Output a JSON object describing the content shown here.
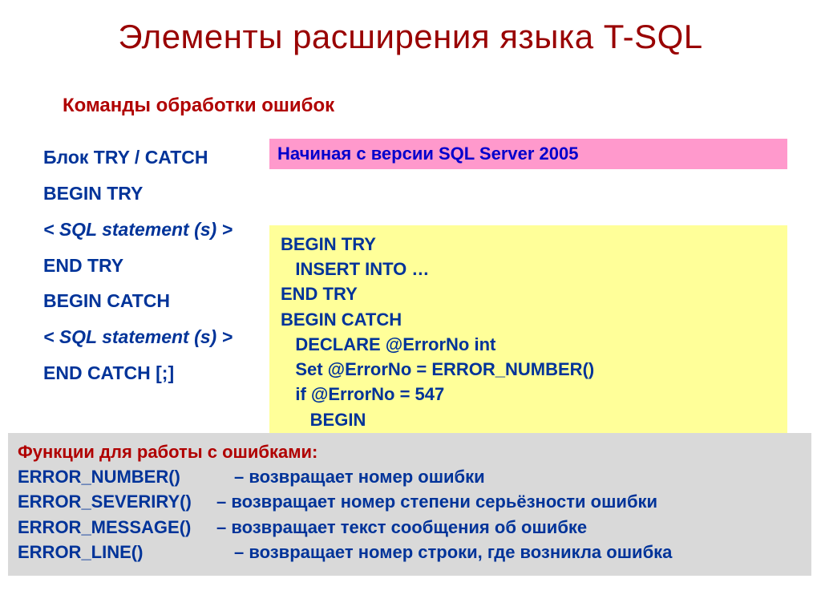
{
  "title": "Элементы расширения языка T-SQL",
  "subtitle": "Команды обработки ошибок",
  "left": {
    "l1": "Блок TRY / CATCH",
    "l2": "BEGIN TRY",
    "l3": " < SQL statement (s)  >",
    "l4": "END TRY",
    "l5": "BEGIN CATCH",
    "l6": "< SQL statement (s) >",
    "l7": " END CATCH [;]"
  },
  "pink": "Начиная с версии SQL Server 2005",
  "yellow": "BEGIN TRY\n   INSERT INTO …\nEND TRY\nBEGIN CATCH\n   DECLARE @ErrorNo int\n   Set @ErrorNo = ERROR_NUMBER()\n   if @ErrorNo = 547\n      BEGIN",
  "gray": {
    "title": "Функции для работы с ошибками:",
    "rows": [
      {
        "fn": "ERROR_NUMBER()",
        "desc": "– возвращает номер ошибки"
      },
      {
        "fn": "ERROR_SEVERIRY()",
        "desc": "– возвращает номер степени серьёзности ошибки"
      },
      {
        "fn": "ERROR_MESSAGE()",
        "desc": "– возвращает текст сообщения об ошибке"
      },
      {
        "fn": "ERROR_LINE()",
        "desc": "– возвращает номер строки, где возникла ошибка"
      }
    ]
  }
}
